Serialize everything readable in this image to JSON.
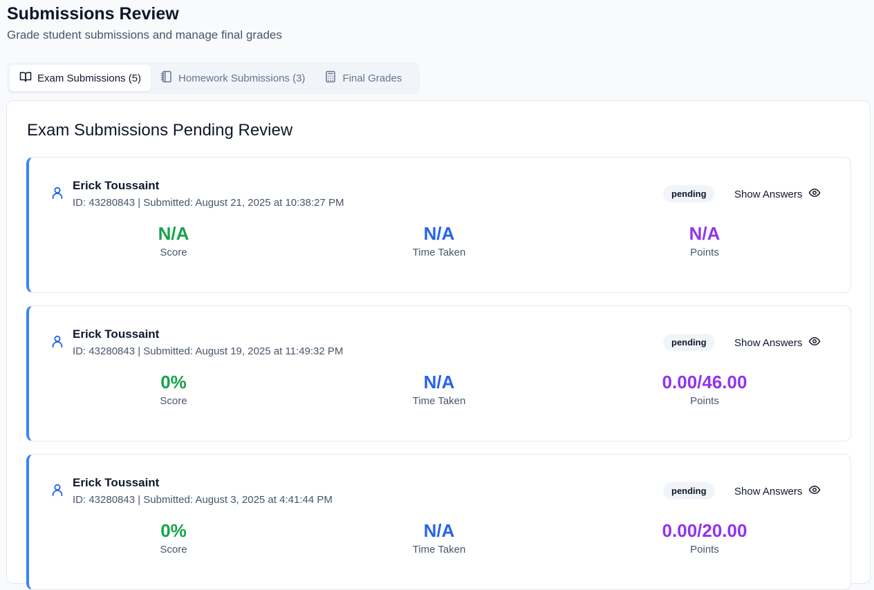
{
  "header": {
    "title": "Submissions Review",
    "subtitle": "Grade student submissions and manage final grades"
  },
  "tabs": [
    {
      "label": "Exam Submissions (5)",
      "icon": "book-open-icon",
      "active": true
    },
    {
      "label": "Homework Submissions (3)",
      "icon": "notebook-icon",
      "active": false
    },
    {
      "label": "Final Grades",
      "icon": "calculator-icon",
      "active": false
    }
  ],
  "panel": {
    "title": "Exam Submissions Pending Review"
  },
  "labels": {
    "score": "Score",
    "time_taken": "Time Taken",
    "points": "Points",
    "show_answers": "Show Answers"
  },
  "colors": {
    "accent_border": "#3b82f6",
    "score": "#16a34a",
    "time": "#2563eb",
    "points": "#9333ea"
  },
  "submissions": [
    {
      "name": "Erick Toussaint",
      "meta": "ID: 43280843 | Submitted: August 21, 2025 at 10:38:27 PM",
      "status": "pending",
      "score": "N/A",
      "time_taken": "N/A",
      "points": "N/A"
    },
    {
      "name": "Erick Toussaint",
      "meta": "ID: 43280843 | Submitted: August 19, 2025 at 11:49:32 PM",
      "status": "pending",
      "score": "0%",
      "time_taken": "N/A",
      "points": "0.00/46.00"
    },
    {
      "name": "Erick Toussaint",
      "meta": "ID: 43280843 | Submitted: August 3, 2025 at 4:41:44 PM",
      "status": "pending",
      "score": "0%",
      "time_taken": "N/A",
      "points": "0.00/20.00"
    }
  ]
}
